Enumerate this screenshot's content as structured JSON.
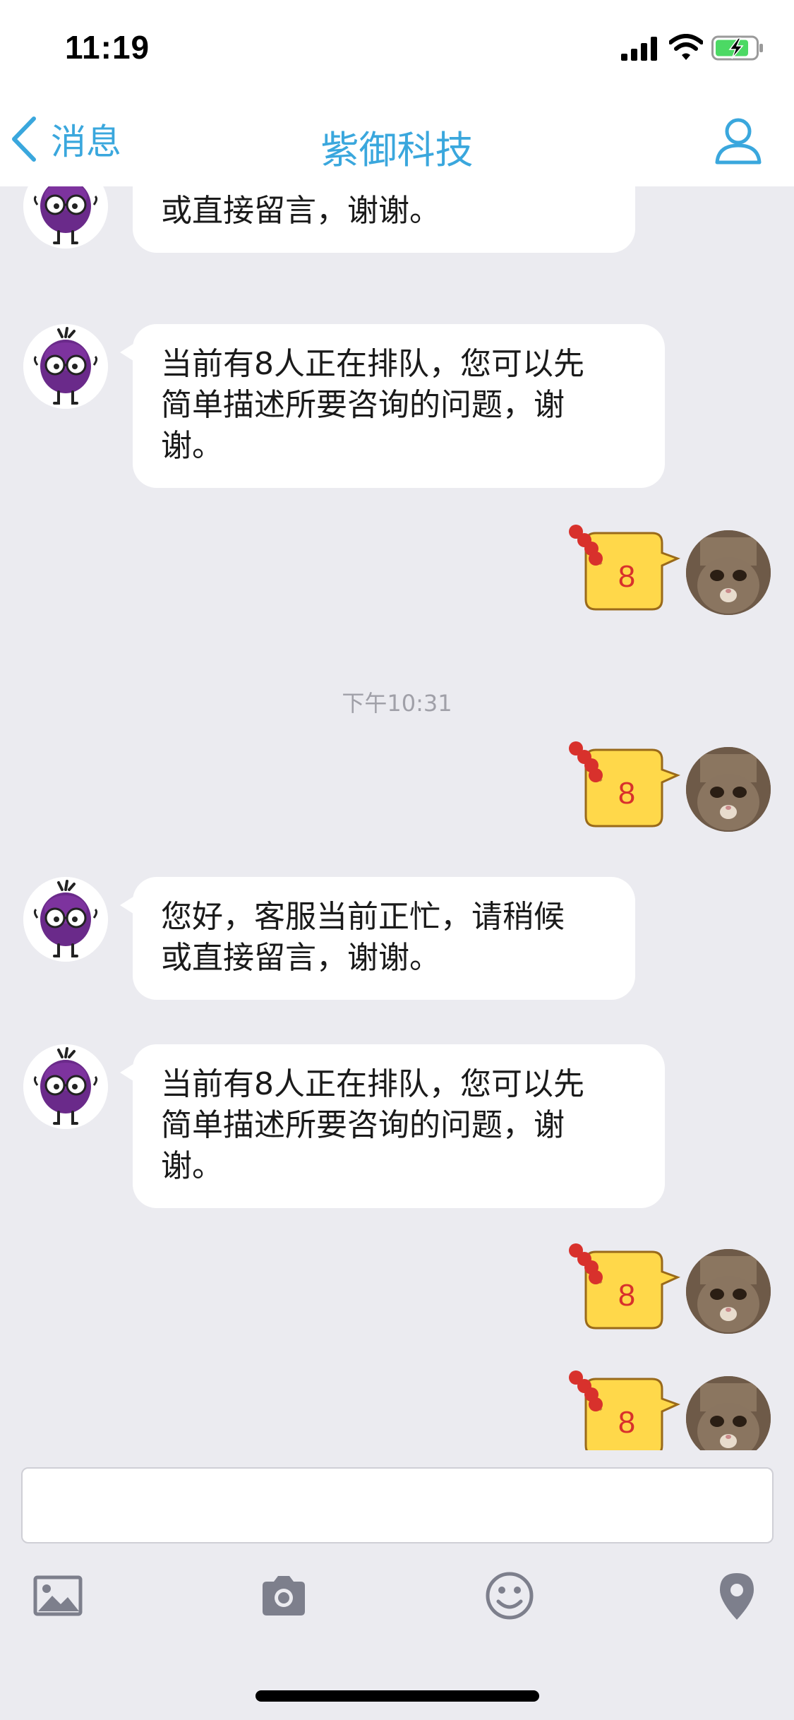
{
  "status_bar": {
    "time": "11:19"
  },
  "nav": {
    "back_label": "消息",
    "title": "紫御科技"
  },
  "messages": {
    "bot_busy": "您好，客服当前正忙，请稍候\n或直接留言，谢谢。",
    "bot_queue": "当前有8人正在排队，您可以先\n简单描述所要咨询的问题，谢\n谢。",
    "sticker_number": "8",
    "timestamp": "下午10:31"
  },
  "colors": {
    "accent": "#3aa7dd",
    "background": "#ebebf0",
    "bubble": "#ffffff",
    "timestamp": "#a0a0a8",
    "toolbar_icons": "#7d7f8c",
    "sticker_fill": "#ffd84a",
    "sticker_candy": "#d8312c"
  },
  "toolbar": {
    "icons": [
      "image-icon",
      "camera-icon",
      "emoji-icon",
      "location-icon"
    ]
  }
}
